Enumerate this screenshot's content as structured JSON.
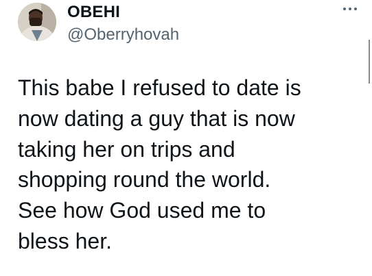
{
  "tweet": {
    "author": {
      "display_name": "OBEHI",
      "handle": "@Oberryhovah",
      "avatar_icon": "user-photo-avatar"
    },
    "more_icon": "more-options-icon",
    "text_lines": [
      "This babe I refused to date is",
      "now dating a guy that is now",
      "taking her on trips and",
      "shopping round the world.",
      "See how God used me to",
      "bless her."
    ]
  },
  "colors": {
    "text_primary": "#0f1419",
    "text_secondary": "#536471",
    "background": "#ffffff"
  }
}
